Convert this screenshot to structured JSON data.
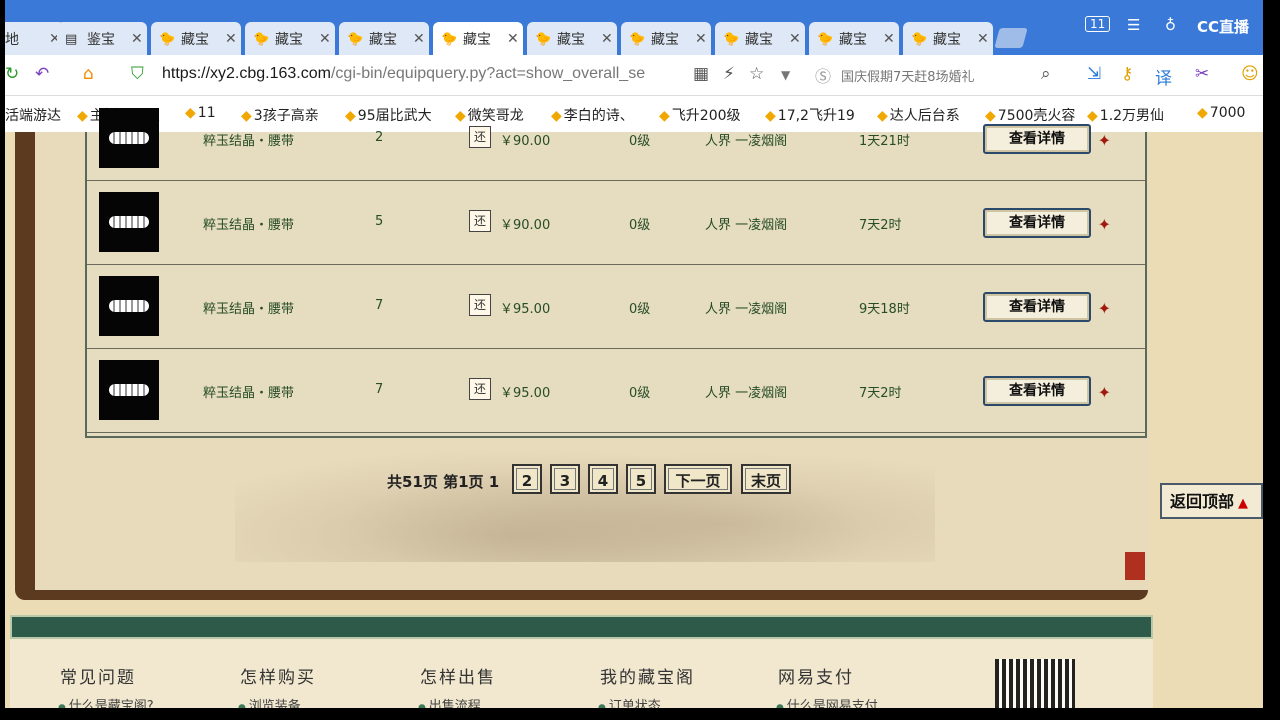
{
  "browser": {
    "tabs": [
      {
        "title": "地",
        "icon": "page-icon",
        "active": false
      },
      {
        "title": "鉴宝",
        "icon": "doc-icon",
        "active": false
      },
      {
        "title": "藏宝",
        "icon": "chick-icon",
        "active": false
      },
      {
        "title": "藏宝",
        "icon": "chick-icon",
        "active": false
      },
      {
        "title": "藏宝",
        "icon": "chick-icon",
        "active": false
      },
      {
        "title": "藏宝",
        "icon": "chick-icon",
        "active": true
      },
      {
        "title": "藏宝",
        "icon": "chick-icon",
        "active": false
      },
      {
        "title": "藏宝",
        "icon": "chick-icon",
        "active": false
      },
      {
        "title": "藏宝",
        "icon": "chick-icon",
        "active": false
      },
      {
        "title": "藏宝",
        "icon": "chick-icon",
        "active": false
      },
      {
        "title": "藏宝",
        "icon": "chick-icon",
        "active": false
      }
    ],
    "tab_count": "11",
    "brand": "CC直播",
    "url_main": "https://xy2.cbg.163.com",
    "url_rest": "/cgi-bin/equipquery.py?act=show_overall_se",
    "search_text": "国庆假期7天赶8场婚礼",
    "bookmarks": [
      "活端游达",
      "主播公会服",
      "11",
      "3孩子高亲",
      "95届比武大",
      "微笑哥龙",
      "李白的诗、",
      "飞升200级",
      "17,2飞升19",
      "达人后台系",
      "7500壳火容",
      "1.2万男仙",
      "7000"
    ]
  },
  "listing": {
    "rows": [
      {
        "name": "粹玉结晶・腰带",
        "qty": "2",
        "badge": "还",
        "price": "￥90.00",
        "level": "0级",
        "server": "人界 一凌烟阁",
        "time": "1天21时",
        "action": "查看详情"
      },
      {
        "name": "粹玉结晶・腰带",
        "qty": "5",
        "badge": "还",
        "price": "￥90.00",
        "level": "0级",
        "server": "人界 一凌烟阁",
        "time": "7天2时",
        "action": "查看详情"
      },
      {
        "name": "粹玉结晶・腰带",
        "qty": "7",
        "badge": "还",
        "price": "￥95.00",
        "level": "0级",
        "server": "人界 一凌烟阁",
        "time": "9天18时",
        "action": "查看详情"
      },
      {
        "name": "粹玉结晶・腰带",
        "qty": "7",
        "badge": "还",
        "price": "￥95.00",
        "level": "0级",
        "server": "人界 一凌烟阁",
        "time": "7天2时",
        "action": "查看详情"
      }
    ]
  },
  "pager": {
    "info": "共51页 第1页 1",
    "pages": [
      "2",
      "3",
      "4",
      "5"
    ],
    "next": "下一页",
    "last": "末页"
  },
  "back_to_top": "返回顶部",
  "footer": {
    "headings": [
      "常见问题",
      "怎样购买",
      "怎样出售",
      "我的藏宝阁",
      "网易支付"
    ],
    "links": [
      "什么是藏宝阁?",
      "浏览装备",
      "出售流程",
      "订单状态",
      "什么是网易支付"
    ]
  }
}
